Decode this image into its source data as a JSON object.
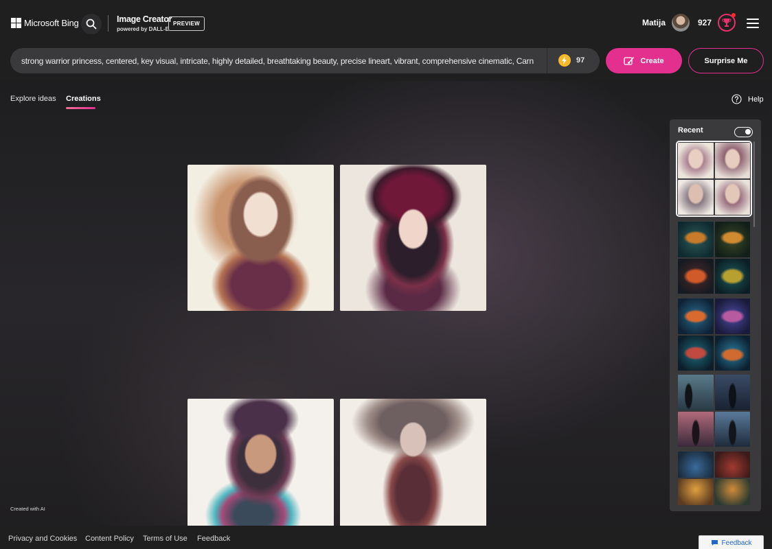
{
  "header": {
    "brand": "Microsoft Bing",
    "product_title": "Image Creator",
    "product_subtitle": "powered by DALL-E",
    "preview_badge": "PREVIEW",
    "user_name": "Matija",
    "rewards_count": "927"
  },
  "prompt": {
    "value": "strong warrior princess, centered, key visual, intricate, highly detailed, breathtaking beauty, precise lineart, vibrant, comprehensive cinematic, Carne C",
    "boosts": "97",
    "create_label": "Create",
    "surprise_label": "Surprise Me"
  },
  "tabs": {
    "explore": "Explore ideas",
    "creations": "Creations",
    "active": "creations"
  },
  "help_label": "Help",
  "created_with_ai": "Created with AI",
  "recent": {
    "title": "Recent",
    "toggle_on": true
  },
  "footer": {
    "links": [
      "Privacy and Cookies",
      "Content Policy",
      "Terms of Use",
      "Feedback"
    ],
    "feedback_button": "Feedback"
  },
  "colors": {
    "accent": "#e3308f",
    "boost": "#f5b829"
  }
}
